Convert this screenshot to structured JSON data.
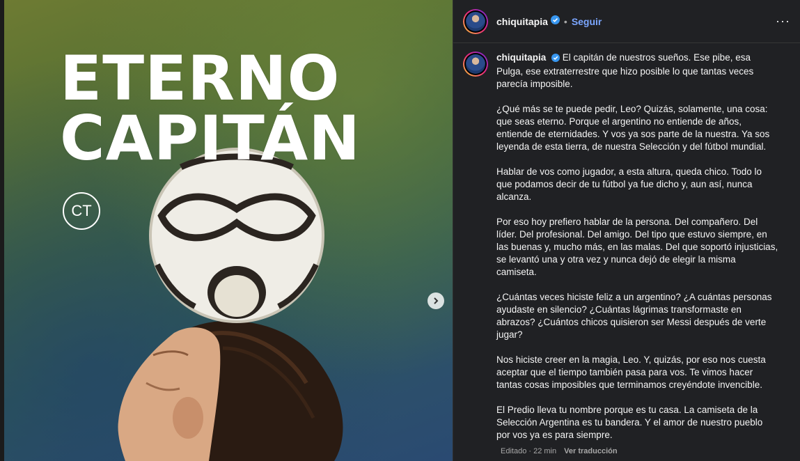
{
  "post": {
    "image": {
      "title_line1": "ETERNO",
      "title_line2": "CAPITÁN",
      "badge": "CT"
    }
  },
  "header": {
    "username": "chiquitapia",
    "separator": "•",
    "follow_label": "Seguir",
    "more_label": "···"
  },
  "caption": {
    "username": "chiquitapia",
    "paragraphs": [
      "El capitán de nuestros sueños. Ese pibe, esa Pulga, ese extraterrestre que hizo posible lo que tantas veces parecía imposible.",
      "¿Qué más se te puede pedir, Leo? Quizás, solamente, una cosa: que seas eterno. Porque el argentino no entiende de años, entiende de eternidades. Y vos ya sos parte de la nuestra. Ya sos leyenda de esta tierra, de nuestra Selección y del fútbol mundial.",
      "Hablar de vos como jugador, a esta altura, queda chico. Todo lo que podamos decir de tu fútbol ya fue dicho y, aun así, nunca alcanza.",
      "Por eso hoy prefiero hablar de la persona. Del compañero. Del líder. Del profesional. Del amigo. Del tipo que estuvo siempre, en las buenas y, mucho más, en las malas. Del que soportó injusticias, se levantó una y otra vez y nunca dejó de elegir la misma camiseta.",
      "¿Cuántas veces hiciste feliz a un argentino? ¿A cuántas personas ayudaste en silencio? ¿Cuántas lágrimas transformaste en abrazos? ¿Cuántos chicos quisieron ser Messi después de verte jugar?",
      "Nos hiciste creer en la magia, Leo. Y, quizás, por eso nos cuesta aceptar que el tiempo también pasa para vos. Te vimos hacer tantas cosas imposibles que terminamos creyéndote invencible.",
      "El Predio lleva tu nombre porque es tu casa. La camiseta de la Selección Argentina es tu bandera. Y el amor de nuestro pueblo por vos ya es para siempre."
    ]
  },
  "meta": {
    "edited": "Editado · 22 min",
    "translate_label": "Ver traducción"
  },
  "colors": {
    "panel_bg": "#202124",
    "link": "#7ba6ff",
    "verified": "#3897f0"
  }
}
